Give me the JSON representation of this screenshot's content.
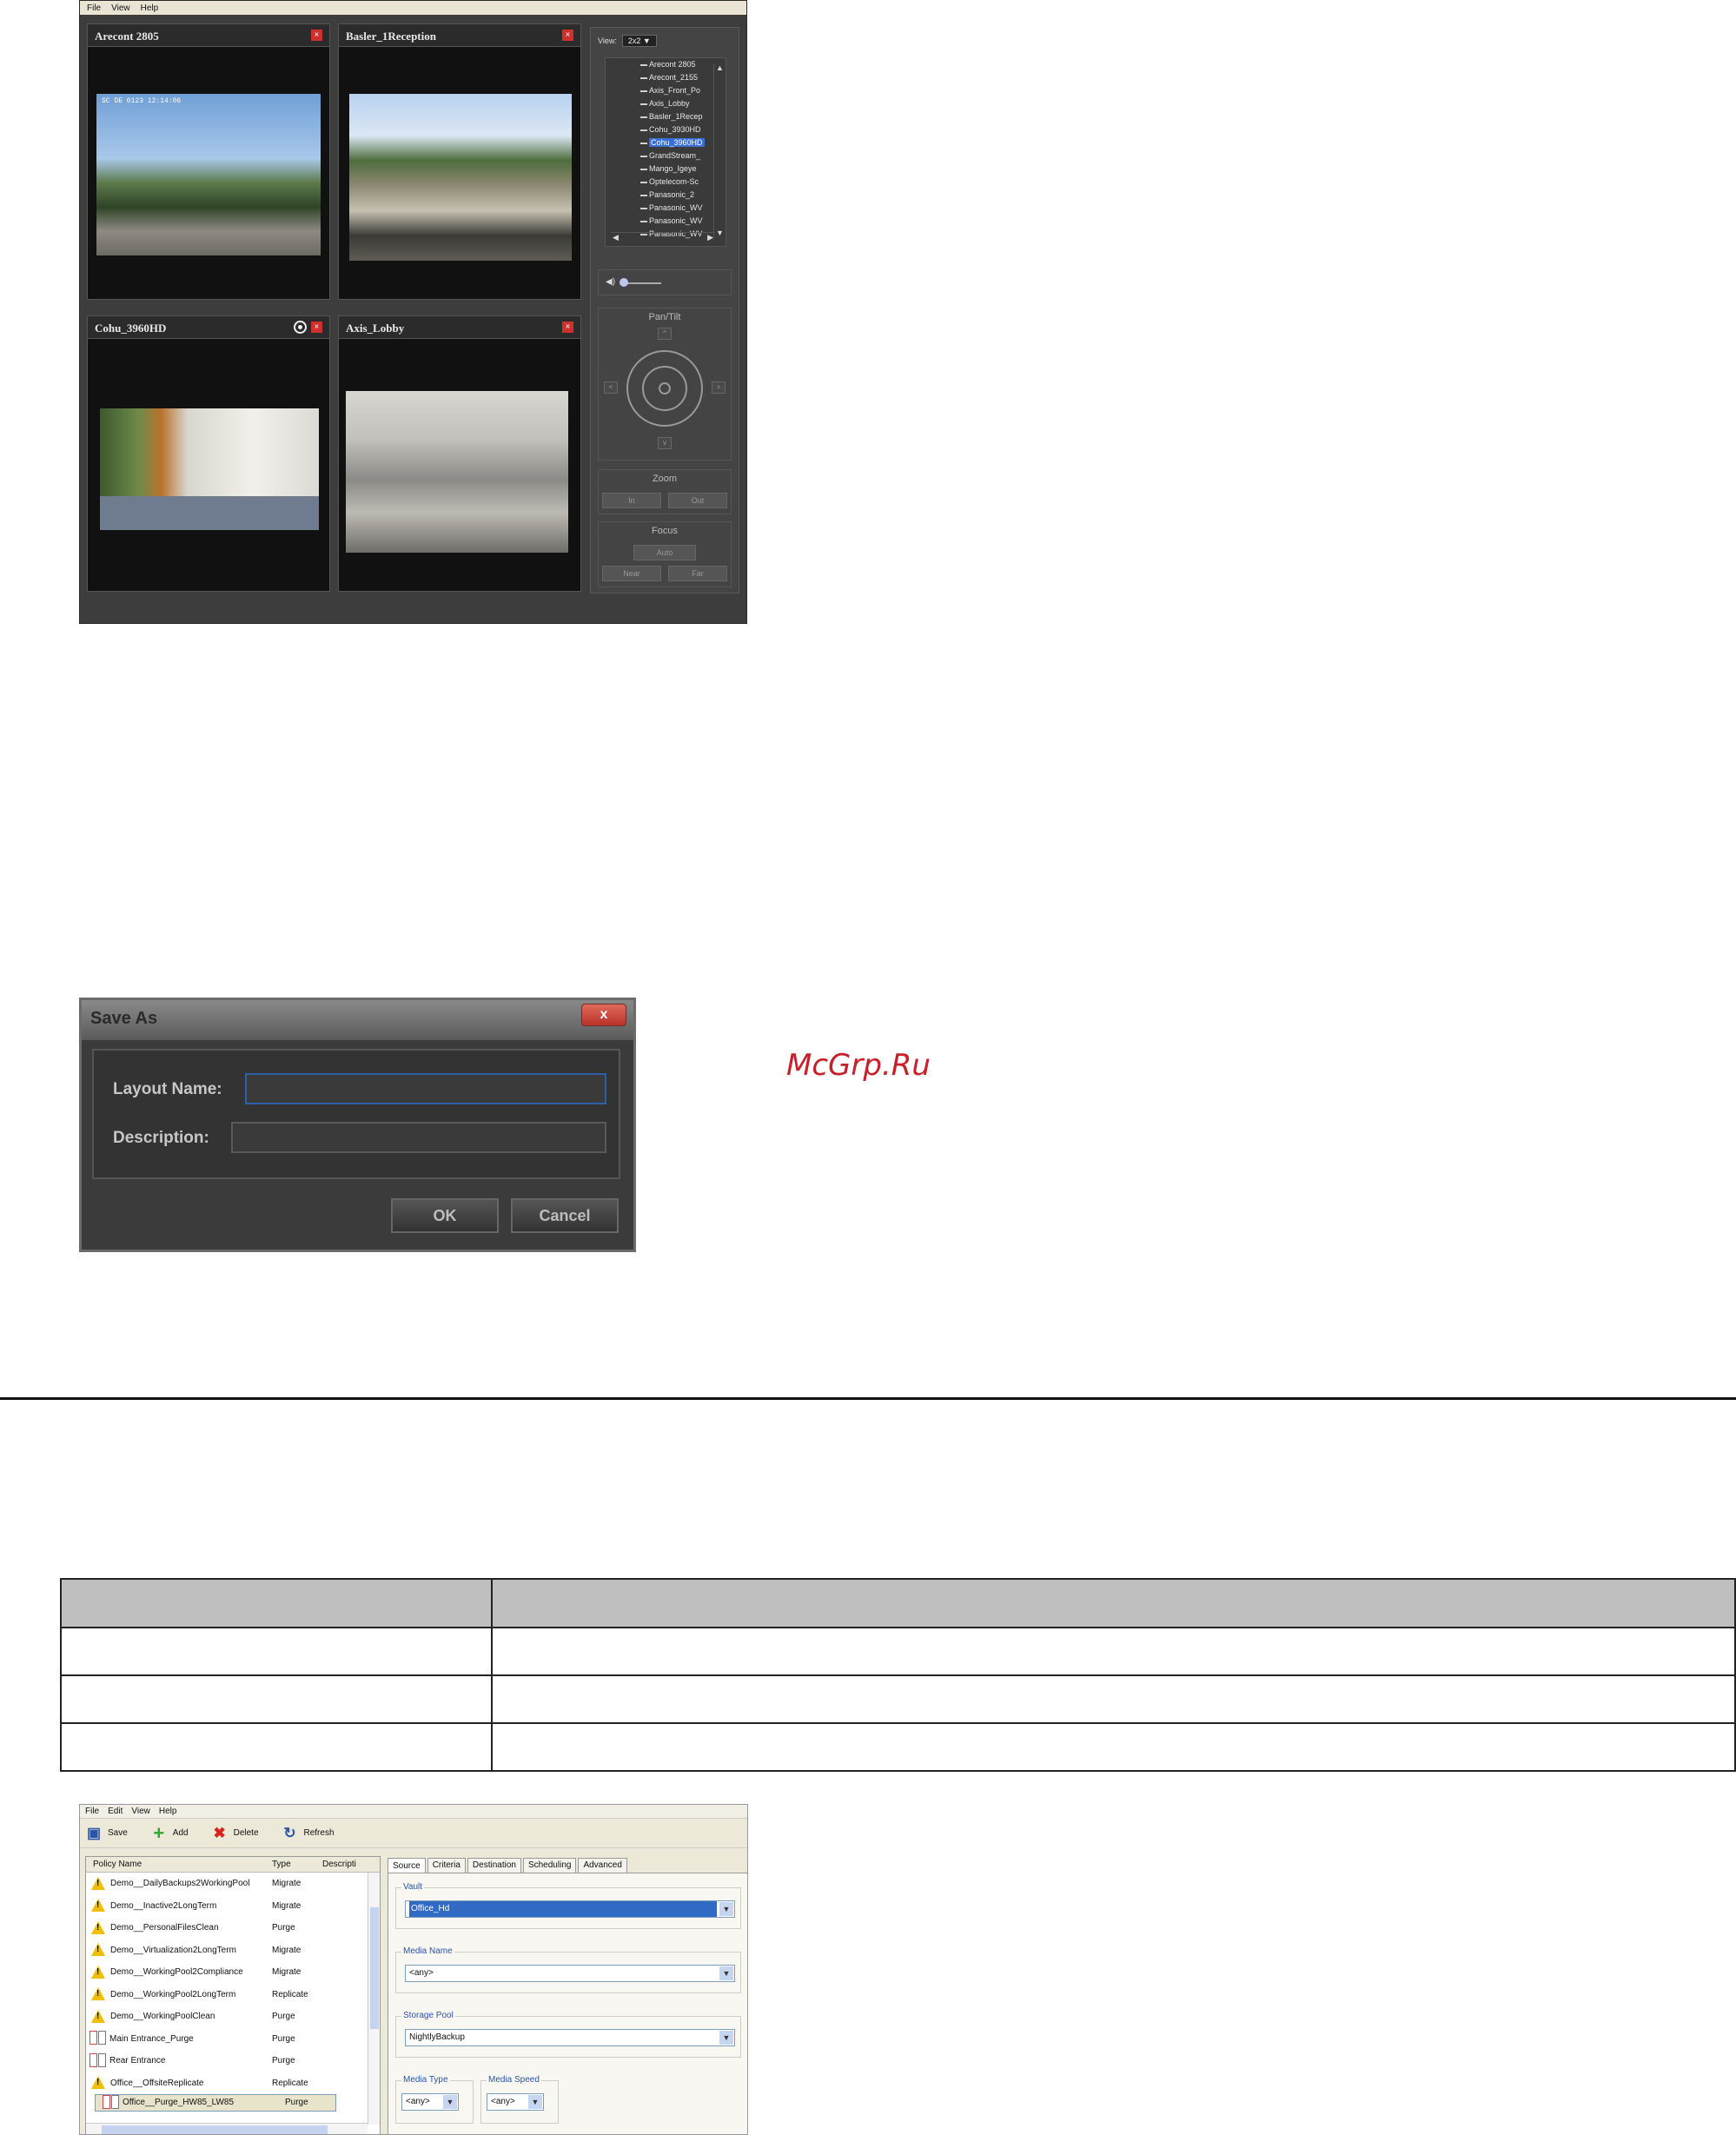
{
  "viewer": {
    "menu": [
      "File",
      "View",
      "Help"
    ],
    "panes": [
      {
        "title": "Arecont 2805",
        "osd": "SC DE 0123 12:14:06"
      },
      {
        "title": "Basler_1Reception"
      },
      {
        "title": "Cohu_3960HD"
      },
      {
        "title": "Axis_Lobby"
      }
    ],
    "view_label": "View:",
    "view_value": "2x2",
    "cameras": [
      "Arecont 2805",
      "Arecont_2155",
      "Axis_Front_Po",
      "Axis_Lobby",
      "Basler_1Recep",
      "Cohu_3930HD",
      "Cohu_3960HD",
      "GrandStream_",
      "Mango_Igeye",
      "Optelecom-Sc",
      "Panasonic_2",
      "Panasonic_WV",
      "Panasonic_WV",
      "Panasonic_WV"
    ],
    "selected_camera_index": 6,
    "pantilt_label": "Pan/Tilt",
    "zoom_label": "Zoom",
    "zoom_in": "In",
    "zoom_out": "Out",
    "focus_label": "Focus",
    "focus_auto": "Auto",
    "focus_near": "Near",
    "focus_far": "Far",
    "icons": {
      "close": "close-icon",
      "record": "record-icon",
      "speaker": "speaker-icon"
    }
  },
  "saveas": {
    "title": "Save As",
    "close": "x",
    "layout_name_label": "Layout Name:",
    "description_label": "Description:",
    "layout_name_value": "",
    "description_value": "",
    "ok": "OK",
    "cancel": "Cancel"
  },
  "watermark": "McGrp.Ru",
  "table": {
    "headers": [
      "",
      ""
    ],
    "rows": [
      [
        "",
        ""
      ],
      [
        "",
        ""
      ],
      [
        "",
        ""
      ]
    ]
  },
  "policy": {
    "menu": [
      "File",
      "Edit",
      "View",
      "Help"
    ],
    "toolbar": {
      "save": "Save",
      "add": "Add",
      "delete": "Delete",
      "refresh": "Refresh"
    },
    "columns": [
      "Policy Name",
      "Type",
      "Descripti"
    ],
    "rows": [
      {
        "name": "Demo__DailyBackups2WorkingPool",
        "type": "Migrate",
        "icon": "warning"
      },
      {
        "name": "Demo__Inactive2LongTerm",
        "type": "Migrate",
        "icon": "warning"
      },
      {
        "name": "Demo__PersonalFilesClean",
        "type": "Purge",
        "icon": "warning"
      },
      {
        "name": "Demo__Virtualization2LongTerm",
        "type": "Migrate",
        "icon": "warning"
      },
      {
        "name": "Demo__WorkingPool2Compliance",
        "type": "Migrate",
        "icon": "warning"
      },
      {
        "name": "Demo__WorkingPool2LongTerm",
        "type": "Replicate",
        "icon": "warning"
      },
      {
        "name": "Demo__WorkingPoolClean",
        "type": "Purge",
        "icon": "warning"
      },
      {
        "name": "Main Entrance_Purge",
        "type": "Purge",
        "icon": "document"
      },
      {
        "name": "Rear Entrance",
        "type": "Purge",
        "icon": "document"
      },
      {
        "name": "Office__OffsiteReplicate",
        "type": "Replicate",
        "icon": "warning"
      },
      {
        "name": "Office__Purge_HW85_LW85",
        "type": "Purge",
        "icon": "document"
      }
    ],
    "selected_row": 10,
    "tabs": [
      "Source",
      "Criteria",
      "Destination",
      "Scheduling",
      "Advanced"
    ],
    "active_tab": "Source",
    "fields": {
      "vault_label": "Vault",
      "vault_value": "Office_Hd",
      "media_name_label": "Media Name",
      "media_name_value": "<any>",
      "storage_pool_label": "Storage Pool",
      "storage_pool_value": "NightlyBackup",
      "media_type_label": "Media Type",
      "media_type_value": "<any>",
      "media_speed_label": "Media Speed",
      "media_speed_value": "<any>"
    },
    "accent": "#316ac5"
  }
}
